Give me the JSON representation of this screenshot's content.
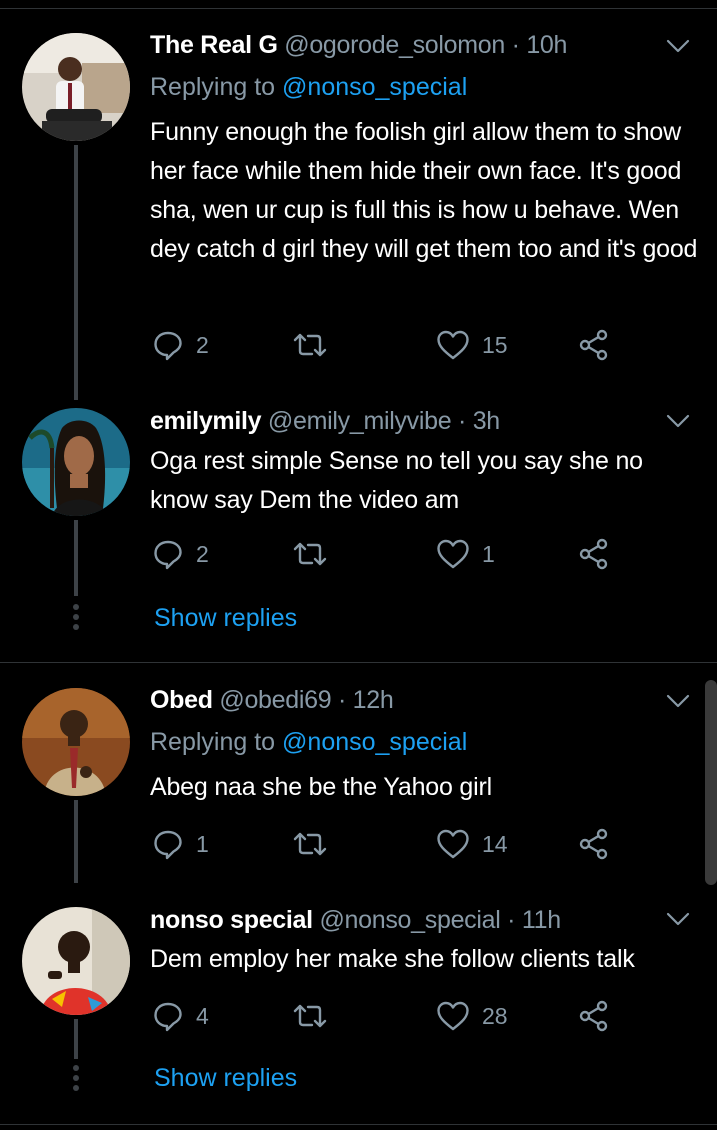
{
  "tweets": [
    {
      "display_name": "The Real G",
      "handle": "@ogorode_solomon",
      "time": "10h",
      "replying_label": "Replying to",
      "replying_to": "@nonso_special",
      "text": "Funny enough the foolish girl allow them to show her face while them hide their own face. It's good sha, wen ur cup is full this is how u behave. Wen dey catch d girl they will get them too and it's good",
      "replies": "2",
      "retweets": "",
      "likes": "15"
    },
    {
      "display_name": "emilymily",
      "handle": "@emily_milyvibe",
      "time": "3h",
      "text": "Oga rest simple Sense no tell you say she no know say Dem the video am",
      "replies": "2",
      "retweets": "",
      "likes": "1",
      "show_replies": "Show replies"
    },
    {
      "display_name": "Obed",
      "handle": "@obedi69",
      "time": "12h",
      "replying_label": "Replying to",
      "replying_to": "@nonso_special",
      "text": "Abeg naa she be the Yahoo girl",
      "replies": "1",
      "retweets": "",
      "likes": "14"
    },
    {
      "display_name": "nonso special",
      "handle": "@nonso_special",
      "time": "11h",
      "text": "Dem employ her make she follow clients talk",
      "replies": "4",
      "retweets": "",
      "likes": "28",
      "show_replies": "Show replies"
    }
  ],
  "separator": "·",
  "icons": {
    "reply": "reply-icon",
    "retweet": "retweet-icon",
    "like": "heart-icon",
    "share": "share-icon",
    "more": "chevron-down-icon"
  },
  "colors": {
    "background": "#000000",
    "primary_text": "#ffffff",
    "secondary_text": "#8899a6",
    "link": "#1da1f2",
    "divider": "#2f3336"
  }
}
